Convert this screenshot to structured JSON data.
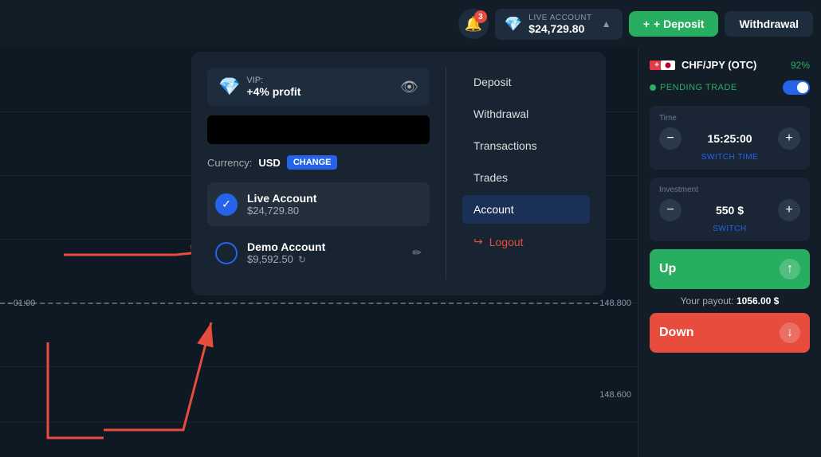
{
  "header": {
    "notif_count": "3",
    "account_label": "LIVE ACCOUNT",
    "account_balance": "$24,729.80",
    "deposit_label": "+ Deposit",
    "withdrawal_label": "Withdrawal"
  },
  "dropdown": {
    "vip_label": "VIP:",
    "vip_profit": "+4% profit",
    "currency_label": "Currency:",
    "currency_value": "USD",
    "change_label": "CHANGE",
    "live_account": {
      "name": "Live Account",
      "balance": "$24,729.80"
    },
    "demo_account": {
      "name": "Demo Account",
      "balance": "$9,592.50"
    },
    "menu": {
      "deposit": "Deposit",
      "withdrawal": "Withdrawal",
      "transactions": "Transactions",
      "trades": "Trades",
      "account": "Account",
      "logout": "Logout"
    }
  },
  "right_panel": {
    "pair_name": "CHF/JPY (OTC)",
    "pair_pct": "92%",
    "pending_trade_label": "PENDING TRADE",
    "time_label": "Time",
    "time_value": "15:25:00",
    "switch_time_label": "SWITCH TIME",
    "investment_label": "Investment",
    "investment_value": "550 $",
    "switch_label": "SWITCH",
    "up_label": "Up",
    "down_label": "Down",
    "payout_label": "Your payout:",
    "payout_value": "1056.00 $"
  },
  "chart": {
    "grid_labels": [
      "148.800",
      "148.600"
    ],
    "time_label": "- 01:00"
  }
}
